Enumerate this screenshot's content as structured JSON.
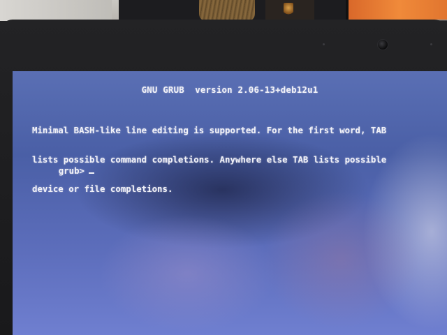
{
  "grub": {
    "header": "GNU GRUB  version 2.06-13+deb12u1",
    "info_lines": [
      "Minimal BASH-like line editing is supported. For the first word, TAB",
      "lists possible command completions. Anywhere else TAB lists possible",
      "device or file completions."
    ],
    "prompt": "grub>",
    "input": ""
  },
  "colors": {
    "screen_background": "#5a6fb4",
    "text": "#f2f2f8",
    "bezel": "#1b1b1d"
  }
}
